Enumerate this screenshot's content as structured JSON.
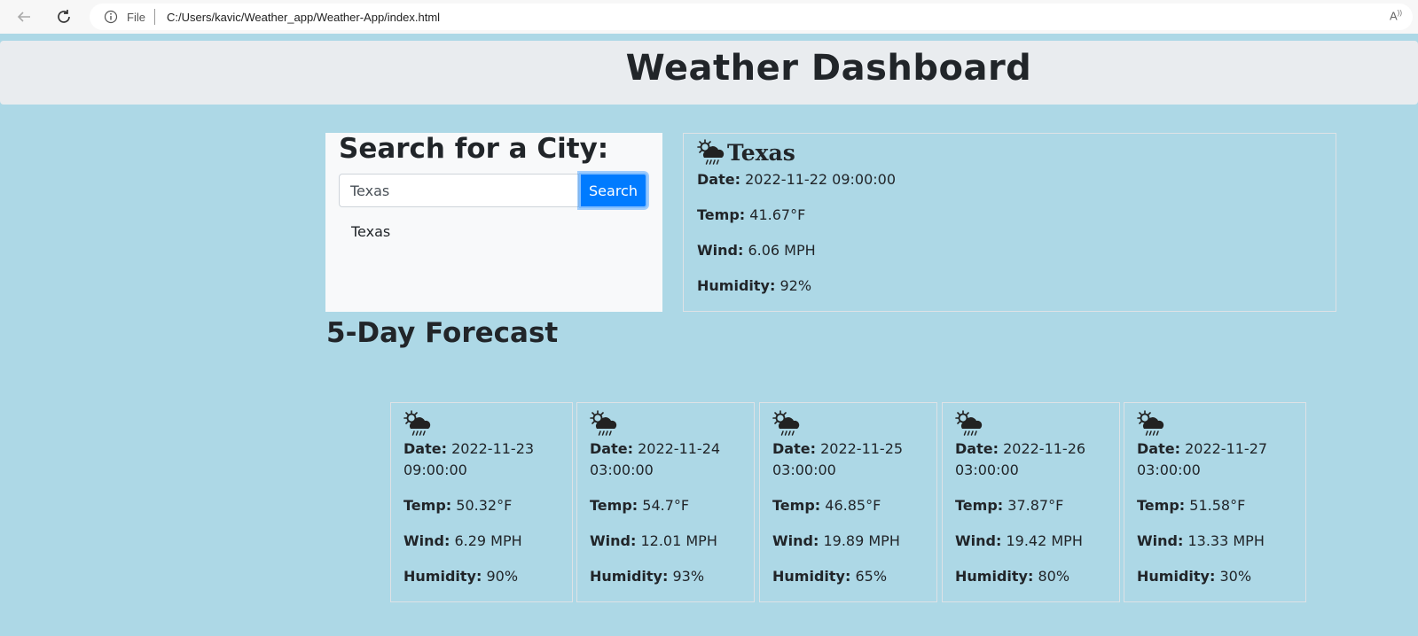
{
  "browser": {
    "file_label": "File",
    "url": "C:/Users/kavic/Weather_app/Weather-App/index.html"
  },
  "header": {
    "title": "Weather Dashboard"
  },
  "search": {
    "title": "Search for a City:",
    "input_value": "Texas",
    "button_label": "Search",
    "history": [
      "Texas"
    ]
  },
  "current": {
    "city": "Texas",
    "icon": "sun-cloud-rain-icon",
    "date_label": "Date:",
    "date": "2022-11-22 09:00:00",
    "temp_label": "Temp:",
    "temp": "41.67°F",
    "wind_label": "Wind:",
    "wind": "6.06 MPH",
    "humidity_label": "Humidity:",
    "humidity": "92%"
  },
  "forecast": {
    "title": "5-Day Forecast",
    "days": [
      {
        "icon": "sun-cloud-rain-icon",
        "date_label": "Date:",
        "date": "2022-11-23",
        "time": "09:00:00",
        "temp_label": "Temp:",
        "temp": "50.32°F",
        "wind_label": "Wind:",
        "wind": "6.29 MPH",
        "humidity_label": "Humidity:",
        "humidity": "90%"
      },
      {
        "icon": "sun-cloud-rain-icon",
        "date_label": "Date:",
        "date": "2022-11-24",
        "time": "03:00:00",
        "temp_label": "Temp:",
        "temp": "54.7°F",
        "wind_label": "Wind:",
        "wind": "12.01 MPH",
        "humidity_label": "Humidity:",
        "humidity": "93%"
      },
      {
        "icon": "sun-cloud-rain-icon",
        "date_label": "Date:",
        "date": "2022-11-25",
        "time": "03:00:00",
        "temp_label": "Temp:",
        "temp": "46.85°F",
        "wind_label": "Wind:",
        "wind": "19.89 MPH",
        "humidity_label": "Humidity:",
        "humidity": "65%"
      },
      {
        "icon": "sun-cloud-rain-icon",
        "date_label": "Date:",
        "date": "2022-11-26",
        "time": "03:00:00",
        "temp_label": "Temp:",
        "temp": "37.87°F",
        "wind_label": "Wind:",
        "wind": "19.42 MPH",
        "humidity_label": "Humidity:",
        "humidity": "80%"
      },
      {
        "icon": "sun-cloud-rain-icon",
        "date_label": "Date:",
        "date": "2022-11-27",
        "time": "03:00:00",
        "temp_label": "Temp:",
        "temp": "51.58°F",
        "wind_label": "Wind:",
        "wind": "13.33 MPH",
        "humidity_label": "Humidity:",
        "humidity": "30%"
      }
    ]
  }
}
